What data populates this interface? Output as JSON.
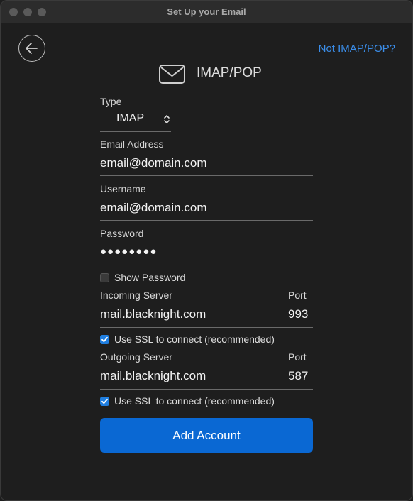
{
  "window": {
    "title": "Set Up your Email"
  },
  "nav": {
    "not_imap_link": "Not IMAP/POP?"
  },
  "header": {
    "title": "IMAP/POP"
  },
  "type": {
    "label": "Type",
    "value": "IMAP"
  },
  "email": {
    "label": "Email Address",
    "value": "email@domain.com"
  },
  "username": {
    "label": "Username",
    "value": "email@domain.com"
  },
  "password": {
    "label": "Password",
    "value": "●●●●●●●●"
  },
  "show_password": {
    "label": "Show Password",
    "checked": false
  },
  "incoming": {
    "server_label": "Incoming Server",
    "server_value": "mail.blacknight.com",
    "port_label": "Port",
    "port_value": "993",
    "ssl_label": "Use SSL to connect (recommended)",
    "ssl_checked": true
  },
  "outgoing": {
    "server_label": "Outgoing Server",
    "server_value": "mail.blacknight.com",
    "port_label": "Port",
    "port_value": "587",
    "ssl_label": "Use SSL to connect (recommended)",
    "ssl_checked": true
  },
  "actions": {
    "add_account": "Add Account"
  },
  "colors": {
    "accent": "#0a68d3",
    "link": "#3b8eea",
    "background": "#1e1e1e"
  },
  "icons": {
    "back": "arrow-left-circle-icon",
    "mail": "envelope-icon",
    "select": "chevron-up-down-icon",
    "check": "checkmark-icon"
  }
}
